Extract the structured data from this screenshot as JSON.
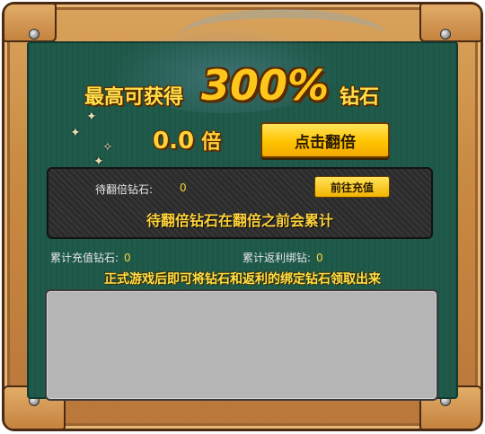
{
  "promo": {
    "prefix": "最高可获得",
    "percent": "300%",
    "suffix": "钻石"
  },
  "multiplier": {
    "value": "0.0",
    "unit": "倍"
  },
  "buttons": {
    "double_label": "点击翻倍",
    "recharge_label": "前往充值"
  },
  "pending": {
    "label": "待翻倍钻石:",
    "value": "0",
    "note": "待翻倍钻石在翻倍之前会累计"
  },
  "stats": {
    "total_recharge_label": "累计充值钻石:",
    "total_recharge_value": "0",
    "total_rebate_label": "累计返利绑钻:",
    "total_rebate_value": "0"
  },
  "footnote": "正式游戏后即可将钻石和返利的绑定钻石领取出来",
  "icons": [
    "star-icon",
    "nail-icon"
  ],
  "colors": {
    "board_green": "#1f5a4a",
    "gold_text": "#ffd23a",
    "button_yellow": "#ffc400",
    "wood": "#c98a42"
  }
}
